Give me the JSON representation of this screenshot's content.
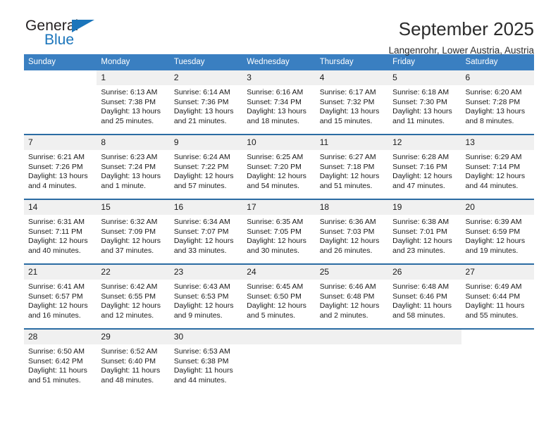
{
  "brand": {
    "name_top": "General",
    "name_bottom": "Blue",
    "triangle_color": "#1b75bb"
  },
  "header": {
    "title": "September 2025",
    "subtitle": "Langenrohr, Lower Austria, Austria"
  },
  "theme": {
    "header_bg": "#3a7fc1",
    "row_divider": "#2b6ca3",
    "daynum_bg": "#f0f0f0",
    "text": "#1a1a1a"
  },
  "weekdays": [
    "Sunday",
    "Monday",
    "Tuesday",
    "Wednesday",
    "Thursday",
    "Friday",
    "Saturday"
  ],
  "weeks": [
    [
      {
        "day": "",
        "sunrise": "",
        "sunset": "",
        "daylight1": "",
        "daylight2": "",
        "blank": true
      },
      {
        "day": "1",
        "sunrise": "Sunrise: 6:13 AM",
        "sunset": "Sunset: 7:38 PM",
        "daylight1": "Daylight: 13 hours",
        "daylight2": "and 25 minutes."
      },
      {
        "day": "2",
        "sunrise": "Sunrise: 6:14 AM",
        "sunset": "Sunset: 7:36 PM",
        "daylight1": "Daylight: 13 hours",
        "daylight2": "and 21 minutes."
      },
      {
        "day": "3",
        "sunrise": "Sunrise: 6:16 AM",
        "sunset": "Sunset: 7:34 PM",
        "daylight1": "Daylight: 13 hours",
        "daylight2": "and 18 minutes."
      },
      {
        "day": "4",
        "sunrise": "Sunrise: 6:17 AM",
        "sunset": "Sunset: 7:32 PM",
        "daylight1": "Daylight: 13 hours",
        "daylight2": "and 15 minutes."
      },
      {
        "day": "5",
        "sunrise": "Sunrise: 6:18 AM",
        "sunset": "Sunset: 7:30 PM",
        "daylight1": "Daylight: 13 hours",
        "daylight2": "and 11 minutes."
      },
      {
        "day": "6",
        "sunrise": "Sunrise: 6:20 AM",
        "sunset": "Sunset: 7:28 PM",
        "daylight1": "Daylight: 13 hours",
        "daylight2": "and 8 minutes."
      }
    ],
    [
      {
        "day": "7",
        "sunrise": "Sunrise: 6:21 AM",
        "sunset": "Sunset: 7:26 PM",
        "daylight1": "Daylight: 13 hours",
        "daylight2": "and 4 minutes."
      },
      {
        "day": "8",
        "sunrise": "Sunrise: 6:23 AM",
        "sunset": "Sunset: 7:24 PM",
        "daylight1": "Daylight: 13 hours",
        "daylight2": "and 1 minute."
      },
      {
        "day": "9",
        "sunrise": "Sunrise: 6:24 AM",
        "sunset": "Sunset: 7:22 PM",
        "daylight1": "Daylight: 12 hours",
        "daylight2": "and 57 minutes."
      },
      {
        "day": "10",
        "sunrise": "Sunrise: 6:25 AM",
        "sunset": "Sunset: 7:20 PM",
        "daylight1": "Daylight: 12 hours",
        "daylight2": "and 54 minutes."
      },
      {
        "day": "11",
        "sunrise": "Sunrise: 6:27 AM",
        "sunset": "Sunset: 7:18 PM",
        "daylight1": "Daylight: 12 hours",
        "daylight2": "and 51 minutes."
      },
      {
        "day": "12",
        "sunrise": "Sunrise: 6:28 AM",
        "sunset": "Sunset: 7:16 PM",
        "daylight1": "Daylight: 12 hours",
        "daylight2": "and 47 minutes."
      },
      {
        "day": "13",
        "sunrise": "Sunrise: 6:29 AM",
        "sunset": "Sunset: 7:14 PM",
        "daylight1": "Daylight: 12 hours",
        "daylight2": "and 44 minutes."
      }
    ],
    [
      {
        "day": "14",
        "sunrise": "Sunrise: 6:31 AM",
        "sunset": "Sunset: 7:11 PM",
        "daylight1": "Daylight: 12 hours",
        "daylight2": "and 40 minutes."
      },
      {
        "day": "15",
        "sunrise": "Sunrise: 6:32 AM",
        "sunset": "Sunset: 7:09 PM",
        "daylight1": "Daylight: 12 hours",
        "daylight2": "and 37 minutes."
      },
      {
        "day": "16",
        "sunrise": "Sunrise: 6:34 AM",
        "sunset": "Sunset: 7:07 PM",
        "daylight1": "Daylight: 12 hours",
        "daylight2": "and 33 minutes."
      },
      {
        "day": "17",
        "sunrise": "Sunrise: 6:35 AM",
        "sunset": "Sunset: 7:05 PM",
        "daylight1": "Daylight: 12 hours",
        "daylight2": "and 30 minutes."
      },
      {
        "day": "18",
        "sunrise": "Sunrise: 6:36 AM",
        "sunset": "Sunset: 7:03 PM",
        "daylight1": "Daylight: 12 hours",
        "daylight2": "and 26 minutes."
      },
      {
        "day": "19",
        "sunrise": "Sunrise: 6:38 AM",
        "sunset": "Sunset: 7:01 PM",
        "daylight1": "Daylight: 12 hours",
        "daylight2": "and 23 minutes."
      },
      {
        "day": "20",
        "sunrise": "Sunrise: 6:39 AM",
        "sunset": "Sunset: 6:59 PM",
        "daylight1": "Daylight: 12 hours",
        "daylight2": "and 19 minutes."
      }
    ],
    [
      {
        "day": "21",
        "sunrise": "Sunrise: 6:41 AM",
        "sunset": "Sunset: 6:57 PM",
        "daylight1": "Daylight: 12 hours",
        "daylight2": "and 16 minutes."
      },
      {
        "day": "22",
        "sunrise": "Sunrise: 6:42 AM",
        "sunset": "Sunset: 6:55 PM",
        "daylight1": "Daylight: 12 hours",
        "daylight2": "and 12 minutes."
      },
      {
        "day": "23",
        "sunrise": "Sunrise: 6:43 AM",
        "sunset": "Sunset: 6:53 PM",
        "daylight1": "Daylight: 12 hours",
        "daylight2": "and 9 minutes."
      },
      {
        "day": "24",
        "sunrise": "Sunrise: 6:45 AM",
        "sunset": "Sunset: 6:50 PM",
        "daylight1": "Daylight: 12 hours",
        "daylight2": "and 5 minutes."
      },
      {
        "day": "25",
        "sunrise": "Sunrise: 6:46 AM",
        "sunset": "Sunset: 6:48 PM",
        "daylight1": "Daylight: 12 hours",
        "daylight2": "and 2 minutes."
      },
      {
        "day": "26",
        "sunrise": "Sunrise: 6:48 AM",
        "sunset": "Sunset: 6:46 PM",
        "daylight1": "Daylight: 11 hours",
        "daylight2": "and 58 minutes."
      },
      {
        "day": "27",
        "sunrise": "Sunrise: 6:49 AM",
        "sunset": "Sunset: 6:44 PM",
        "daylight1": "Daylight: 11 hours",
        "daylight2": "and 55 minutes."
      }
    ],
    [
      {
        "day": "28",
        "sunrise": "Sunrise: 6:50 AM",
        "sunset": "Sunset: 6:42 PM",
        "daylight1": "Daylight: 11 hours",
        "daylight2": "and 51 minutes."
      },
      {
        "day": "29",
        "sunrise": "Sunrise: 6:52 AM",
        "sunset": "Sunset: 6:40 PM",
        "daylight1": "Daylight: 11 hours",
        "daylight2": "and 48 minutes."
      },
      {
        "day": "30",
        "sunrise": "Sunrise: 6:53 AM",
        "sunset": "Sunset: 6:38 PM",
        "daylight1": "Daylight: 11 hours",
        "daylight2": "and 44 minutes."
      },
      {
        "day": "",
        "sunrise": "",
        "sunset": "",
        "daylight1": "",
        "daylight2": "",
        "empty": true
      },
      {
        "day": "",
        "sunrise": "",
        "sunset": "",
        "daylight1": "",
        "daylight2": "",
        "empty": true
      },
      {
        "day": "",
        "sunrise": "",
        "sunset": "",
        "daylight1": "",
        "daylight2": "",
        "empty": true
      },
      {
        "day": "",
        "sunrise": "",
        "sunset": "",
        "daylight1": "",
        "daylight2": "",
        "blank": true
      }
    ]
  ]
}
